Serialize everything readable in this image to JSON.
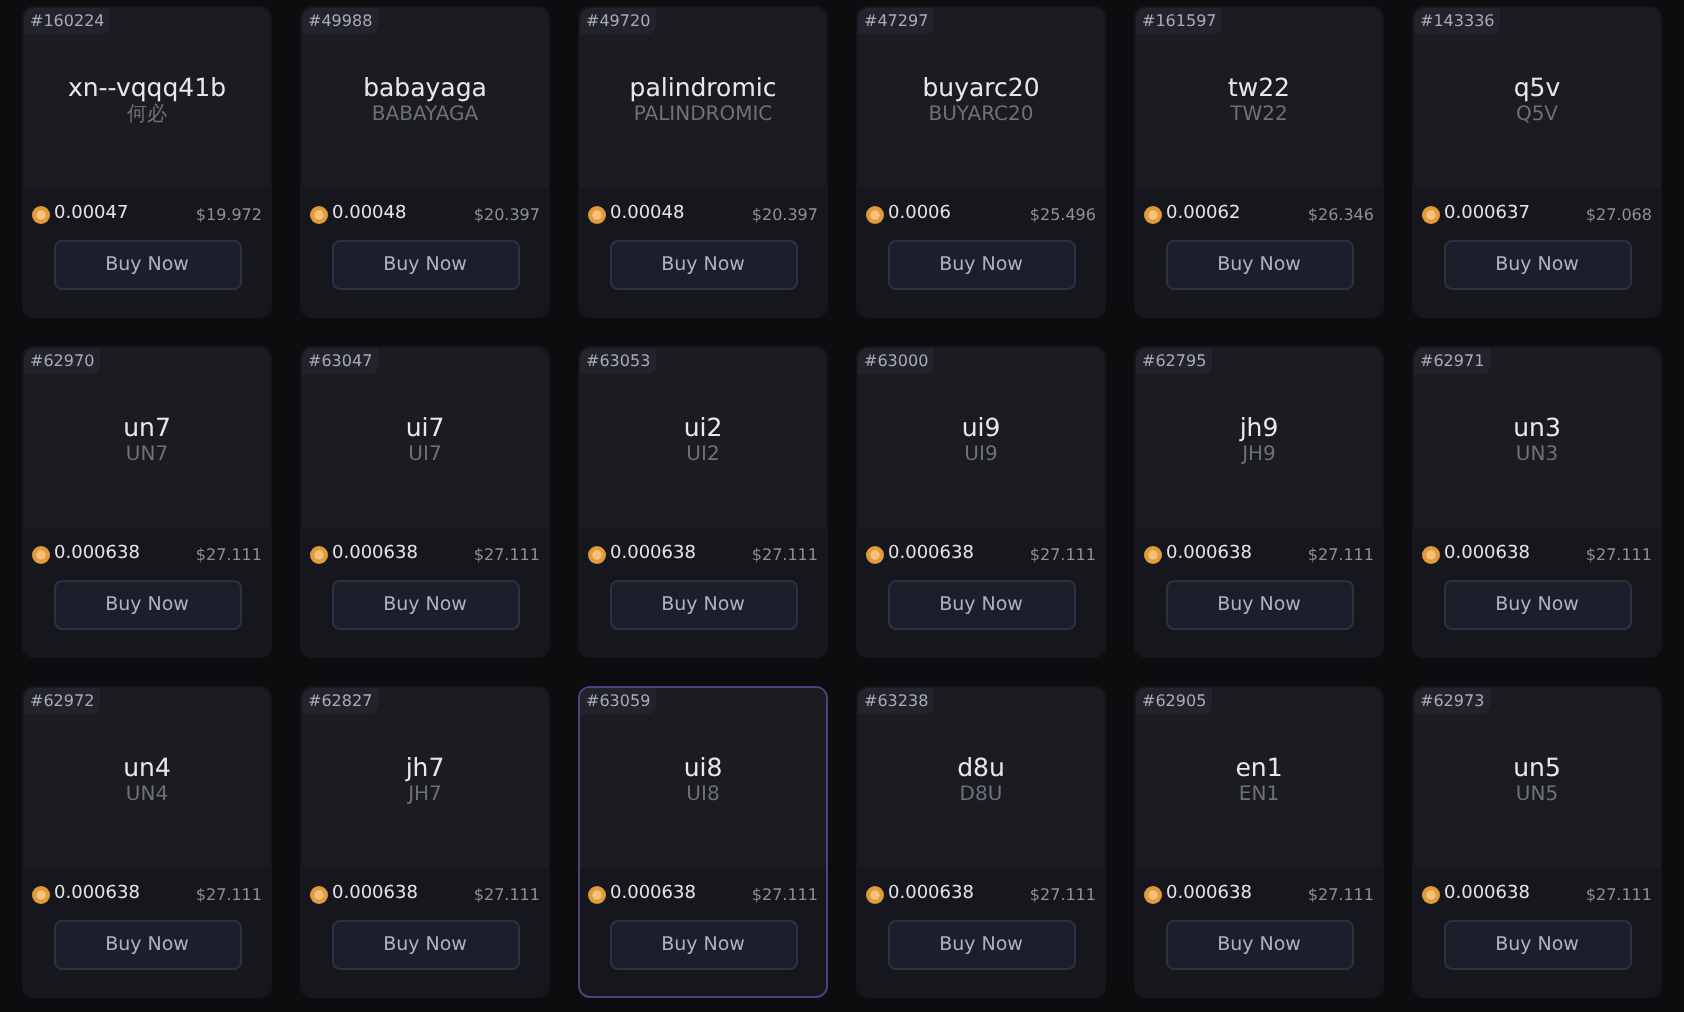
{
  "cards": [
    {
      "id": "#160224",
      "name": "xn--vqqq41b",
      "subtitle": "何必",
      "price": "0.00047",
      "usd": "$19.972",
      "button": "Buy Now",
      "selected": false
    },
    {
      "id": "#49988",
      "name": "babayaga",
      "subtitle": "BABAYAGA",
      "price": "0.00048",
      "usd": "$20.397",
      "button": "Buy Now",
      "selected": false
    },
    {
      "id": "#49720",
      "name": "palindromic",
      "subtitle": "PALINDROMIC",
      "price": "0.00048",
      "usd": "$20.397",
      "button": "Buy Now",
      "selected": false
    },
    {
      "id": "#47297",
      "name": "buyarc20",
      "subtitle": "BUYARC20",
      "price": "0.0006",
      "usd": "$25.496",
      "button": "Buy Now",
      "selected": false
    },
    {
      "id": "#161597",
      "name": "tw22",
      "subtitle": "TW22",
      "price": "0.00062",
      "usd": "$26.346",
      "button": "Buy Now",
      "selected": false
    },
    {
      "id": "#143336",
      "name": "q5v",
      "subtitle": "Q5V",
      "price": "0.000637",
      "usd": "$27.068",
      "button": "Buy Now",
      "selected": false
    },
    {
      "id": "#62970",
      "name": "un7",
      "subtitle": "UN7",
      "price": "0.000638",
      "usd": "$27.111",
      "button": "Buy Now",
      "selected": false
    },
    {
      "id": "#63047",
      "name": "ui7",
      "subtitle": "UI7",
      "price": "0.000638",
      "usd": "$27.111",
      "button": "Buy Now",
      "selected": false
    },
    {
      "id": "#63053",
      "name": "ui2",
      "subtitle": "UI2",
      "price": "0.000638",
      "usd": "$27.111",
      "button": "Buy Now",
      "selected": false
    },
    {
      "id": "#63000",
      "name": "ui9",
      "subtitle": "UI9",
      "price": "0.000638",
      "usd": "$27.111",
      "button": "Buy Now",
      "selected": false
    },
    {
      "id": "#62795",
      "name": "jh9",
      "subtitle": "JH9",
      "price": "0.000638",
      "usd": "$27.111",
      "button": "Buy Now",
      "selected": false
    },
    {
      "id": "#62971",
      "name": "un3",
      "subtitle": "UN3",
      "price": "0.000638",
      "usd": "$27.111",
      "button": "Buy Now",
      "selected": false
    },
    {
      "id": "#62972",
      "name": "un4",
      "subtitle": "UN4",
      "price": "0.000638",
      "usd": "$27.111",
      "button": "Buy Now",
      "selected": false
    },
    {
      "id": "#62827",
      "name": "jh7",
      "subtitle": "JH7",
      "price": "0.000638",
      "usd": "$27.111",
      "button": "Buy Now",
      "selected": false
    },
    {
      "id": "#63059",
      "name": "ui8",
      "subtitle": "UI8",
      "price": "0.000638",
      "usd": "$27.111",
      "button": "Buy Now",
      "selected": true
    },
    {
      "id": "#63238",
      "name": "d8u",
      "subtitle": "D8U",
      "price": "0.000638",
      "usd": "$27.111",
      "button": "Buy Now",
      "selected": false
    },
    {
      "id": "#62905",
      "name": "en1",
      "subtitle": "EN1",
      "price": "0.000638",
      "usd": "$27.111",
      "button": "Buy Now",
      "selected": false
    },
    {
      "id": "#62973",
      "name": "un5",
      "subtitle": "UN5",
      "price": "0.000638",
      "usd": "$27.111",
      "button": "Buy Now",
      "selected": false
    }
  ]
}
